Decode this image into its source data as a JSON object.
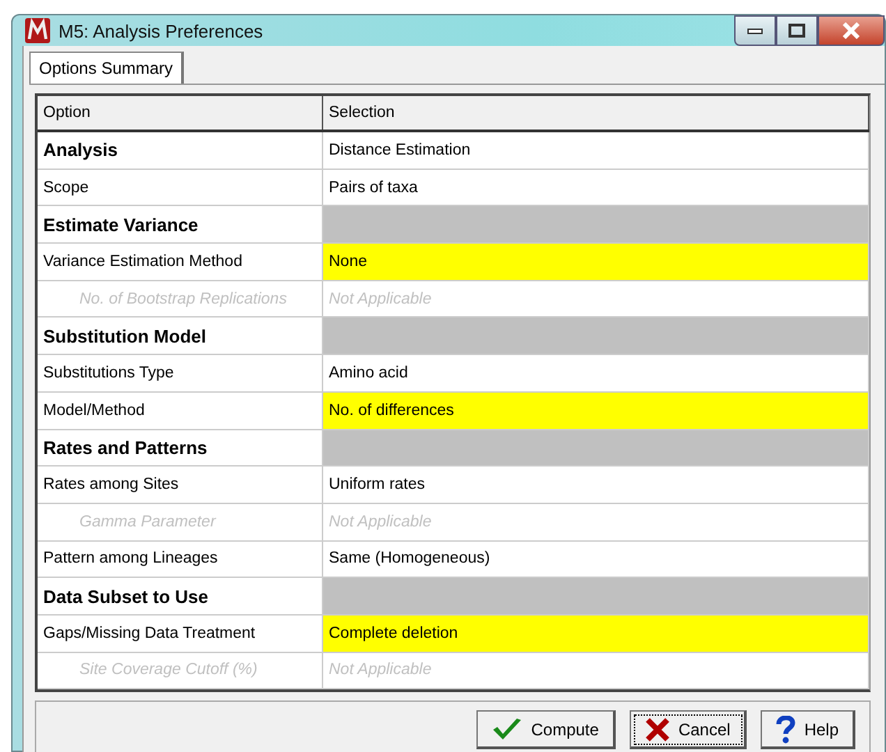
{
  "window": {
    "title": "M5: Analysis Preferences"
  },
  "tabs": [
    {
      "label": "Options Summary",
      "selected": true
    }
  ],
  "table": {
    "columns": [
      "Option",
      "Selection"
    ],
    "rows": [
      {
        "kind": "section",
        "option": "Analysis",
        "selection": "Distance Estimation",
        "highlighted": false
      },
      {
        "kind": "option",
        "option": "Scope",
        "selection": "Pairs of taxa",
        "highlighted": false
      },
      {
        "kind": "section",
        "option": "Estimate Variance",
        "highlighted": false
      },
      {
        "kind": "option",
        "option": "Variance Estimation Method",
        "selection": "None",
        "highlighted": true
      },
      {
        "kind": "disabled",
        "option": "No. of Bootstrap Replications",
        "selection": "Not Applicable",
        "highlighted": false
      },
      {
        "kind": "section",
        "option": "Substitution Model",
        "highlighted": false
      },
      {
        "kind": "option",
        "option": "Substitutions Type",
        "selection": "Amino acid",
        "highlighted": false
      },
      {
        "kind": "option",
        "option": "Model/Method",
        "selection": "No. of differences",
        "highlighted": true
      },
      {
        "kind": "section",
        "option": "Rates and Patterns",
        "highlighted": false
      },
      {
        "kind": "option",
        "option": "Rates among Sites",
        "selection": "Uniform rates",
        "highlighted": false
      },
      {
        "kind": "disabled",
        "option": "Gamma Parameter",
        "selection": "Not Applicable",
        "highlighted": false
      },
      {
        "kind": "option",
        "option": "Pattern among Lineages",
        "selection": "Same (Homogeneous)",
        "highlighted": false
      },
      {
        "kind": "section",
        "option": "Data Subset to Use",
        "highlighted": false
      },
      {
        "kind": "option",
        "option": "Gaps/Missing Data Treatment",
        "selection": "Complete deletion",
        "highlighted": true
      },
      {
        "kind": "disabled",
        "option": "Site Coverage Cutoff (%)",
        "selection": "Not Applicable",
        "highlighted": false
      }
    ]
  },
  "buttons": [
    {
      "kind": "compute",
      "label": "Compute",
      "focused": false
    },
    {
      "kind": "cancel",
      "label": "Cancel",
      "focused": true
    },
    {
      "kind": "help",
      "label": "Help",
      "focused": false
    }
  ]
}
